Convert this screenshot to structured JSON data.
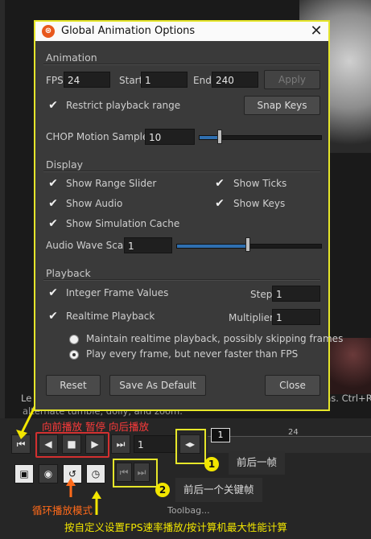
{
  "dialog": {
    "title": "Global Animation Options",
    "close_glyph": "✕",
    "animation": {
      "section": "Animation",
      "fps_label": "FPS",
      "fps_value": "24",
      "start_label": "Start",
      "start_value": "1",
      "end_label": "End",
      "end_value": "240",
      "apply_label": "Apply",
      "restrict_label": "Restrict playback range",
      "snap_keys_label": "Snap Keys",
      "chop_label": "CHOP Motion Samples",
      "chop_value": "10"
    },
    "display": {
      "section": "Display",
      "show_range_slider": "Show Range Slider",
      "show_ticks": "Show Ticks",
      "show_audio": "Show Audio",
      "show_keys": "Show Keys",
      "show_sim_cache": "Show Simulation Cache",
      "audio_wave_label": "Audio Wave Scale",
      "audio_wave_value": "1"
    },
    "playback": {
      "section": "Playback",
      "integer_frames": "Integer Frame Values",
      "step_label": "Step",
      "step_value": "1",
      "realtime": "Realtime Playback",
      "multiplier_label": "Multiplier",
      "multiplier_value": "1",
      "radio_option_1": "Maintain realtime playback, possibly skipping frames",
      "radio_option_2": "Play every frame, but never faster than FPS"
    },
    "buttons": {
      "reset": "Reset",
      "save_default": "Save As Default",
      "close": "Close"
    }
  },
  "background": {
    "hint_line1": "Le",
    "hint_line2": "alternate tumble, dolly, and zoom.",
    "hint_right": "ns. Ctrl+Ri"
  },
  "timeline": {
    "frame_value": "1",
    "ruler_tick": "24",
    "current_frame_tag": "1",
    "toolbag_text": "Toolbag..."
  },
  "annotations": {
    "playback_directions": "向前播放  暂停  向后播放",
    "badge_1": "1",
    "badge_2": "2",
    "tooltip_1": "前后一帧",
    "tooltip_2": "前后一个关键帧",
    "loop_mode": "循环播放模式",
    "fps_note": "按自定义设置FPS速率播放/按计算机最大性能计算"
  },
  "colors": {
    "highlight_yellow": "#e6e62a",
    "annotation_red": "#ff3b3b",
    "annotation_orange": "#ff6a1a",
    "slider_blue": "#2f6fb0"
  }
}
